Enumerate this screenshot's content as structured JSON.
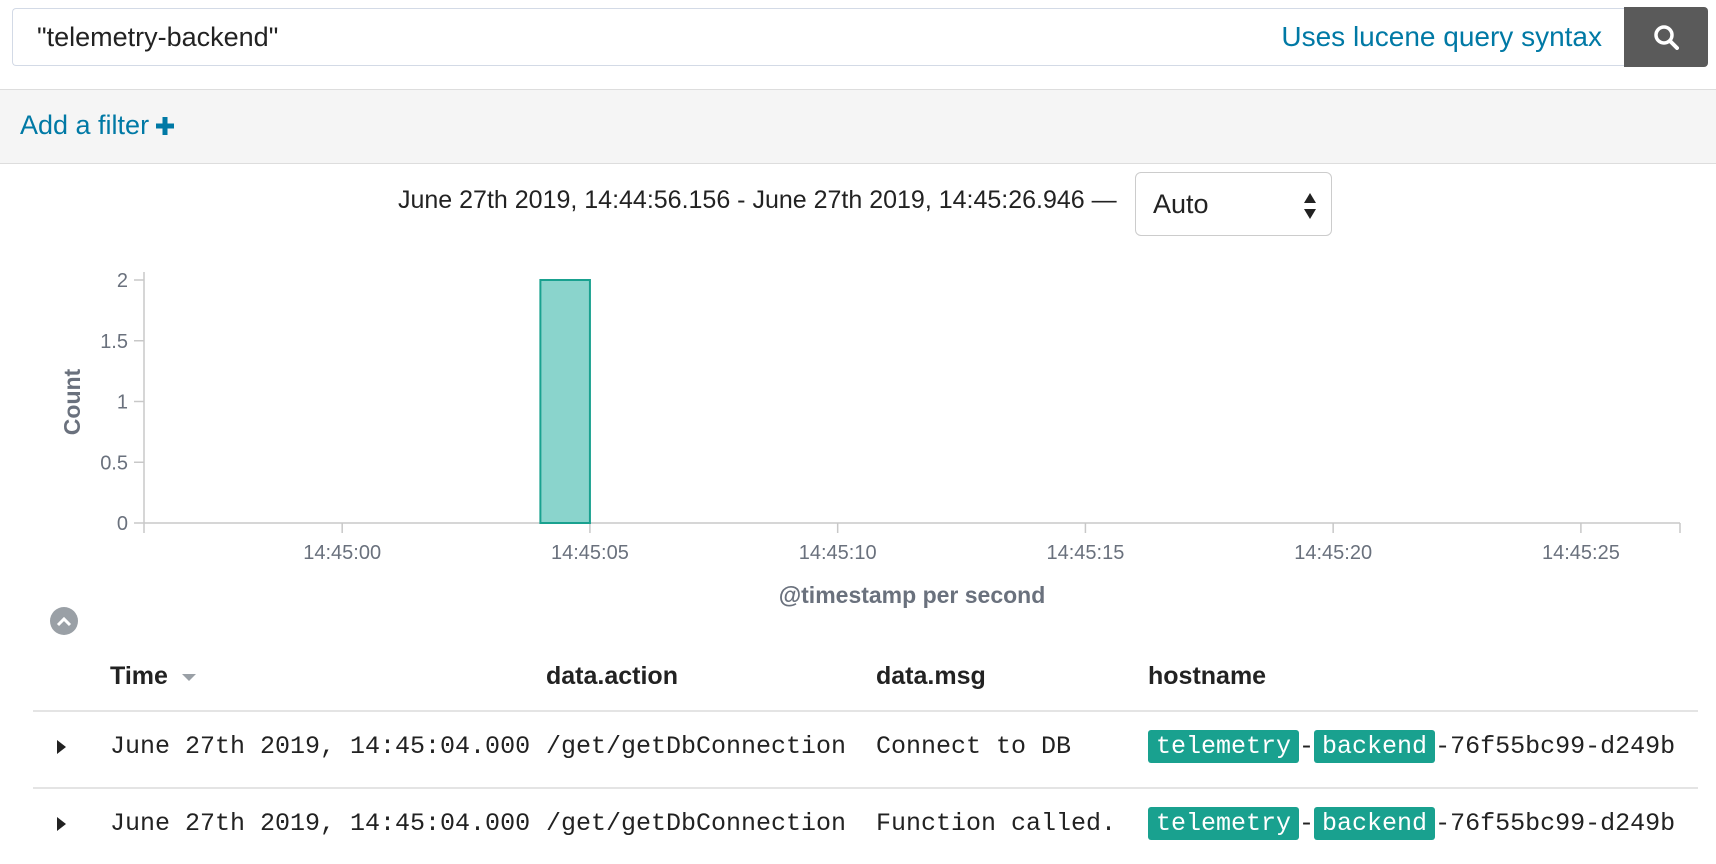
{
  "search": {
    "query": "\"telemetry-backend\"",
    "syntax_link": "Uses lucene query syntax",
    "button_icon": "search-icon"
  },
  "filter_bar": {
    "add_filter_label": "Add a filter",
    "add_filter_icon": "plus-icon"
  },
  "time_range": {
    "label": "June 27th 2019, 14:44:56.156 - June 27th 2019, 14:45:26.946 —",
    "interval": "Auto"
  },
  "chart_data": {
    "type": "bar",
    "x": [
      "14:45:04"
    ],
    "values": [
      2
    ],
    "x_ticks": [
      "14:45:00",
      "14:45:05",
      "14:45:10",
      "14:45:15",
      "14:45:20",
      "14:45:25"
    ],
    "y_ticks": [
      "0",
      "0.5",
      "1",
      "1.5",
      "2"
    ],
    "ylim": [
      0,
      2
    ],
    "xlim": [
      "14:44:56",
      "14:45:27"
    ],
    "xlabel": "@timestamp per second",
    "ylabel": "Count",
    "bar_color": "#8ad4cc",
    "bar_border": "#19a18f",
    "grid": false
  },
  "table": {
    "columns": [
      "Time",
      "data.action",
      "data.msg",
      "hostname"
    ],
    "rows": [
      {
        "time": "June 27th 2019, 14:45:04.000",
        "action": "/get/getDbConnection",
        "msg": "Connect to DB",
        "host_hl1": "telemetry",
        "host_sep": "-",
        "host_hl2": "backend",
        "host_rest": "-76f55bc99-d249b"
      },
      {
        "time": "June 27th 2019, 14:45:04.000",
        "action": "/get/getDbConnection",
        "msg": "Function called.",
        "host_hl1": "telemetry",
        "host_sep": "-",
        "host_hl2": "backend",
        "host_rest": "-76f55bc99-d249b"
      }
    ]
  },
  "colors": {
    "link": "#0079a5",
    "highlight": "#19a18f",
    "search_button": "#5a5a5a"
  }
}
